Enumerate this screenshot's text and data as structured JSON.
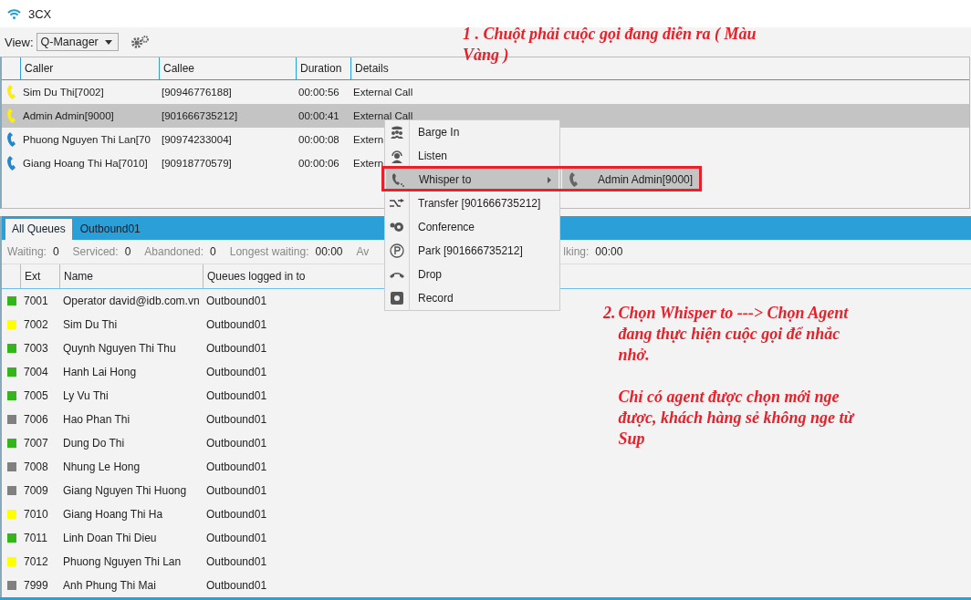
{
  "window": {
    "title": "3CX"
  },
  "toolbar": {
    "view_label": "View:",
    "view_value": "Q-Manager"
  },
  "calls": {
    "columns": [
      "Caller",
      "Callee",
      "Duration",
      "Details"
    ],
    "rows": [
      {
        "caller": "Sim Du Thi[7002]",
        "callee": "[90946776188]",
        "duration": "00:00:56",
        "details": "External Call",
        "color": "#ffee00",
        "selected": false
      },
      {
        "caller": "Admin Admin[9000]",
        "callee": "[901666735212]",
        "duration": "00:00:41",
        "details": "External Call",
        "color": "#ffee00",
        "selected": true
      },
      {
        "caller": "Phuong Nguyen Thi Lan[70",
        "callee": "[90974233004]",
        "duration": "00:00:08",
        "details": "Extern",
        "color": "#1e88d0",
        "selected": false
      },
      {
        "caller": "Giang Hoang Thi Ha[7010]",
        "callee": "[90918770579]",
        "duration": "00:00:06",
        "details": "Extern",
        "color": "#1e88d0",
        "selected": false
      }
    ]
  },
  "context_menu": {
    "items": [
      {
        "label": "Barge In",
        "selected": false,
        "has_submenu": false
      },
      {
        "label": "Listen",
        "selected": false,
        "has_submenu": false
      },
      {
        "label": "Whisper to",
        "selected": true,
        "has_submenu": true
      },
      {
        "label": "Transfer [901666735212]",
        "selected": false,
        "has_submenu": false
      },
      {
        "label": "Conference",
        "selected": false,
        "has_submenu": false
      },
      {
        "label": "Park [901666735212]",
        "selected": false,
        "has_submenu": false
      },
      {
        "label": "Drop",
        "selected": false,
        "has_submenu": false
      },
      {
        "label": "Record",
        "selected": false,
        "has_submenu": false
      }
    ],
    "submenu": [
      {
        "label": "Admin Admin[9000]",
        "selected": true
      }
    ]
  },
  "queues": {
    "tabs": [
      {
        "label": "All Queues",
        "selected": true
      },
      {
        "label": "Outbound01",
        "selected": false
      }
    ],
    "stats": [
      {
        "label": "Waiting:",
        "value": "0"
      },
      {
        "label": "Serviced:",
        "value": "0"
      },
      {
        "label": "Abandoned:",
        "value": "0"
      },
      {
        "label": "Longest waiting:",
        "value": "00:00"
      },
      {
        "label": "Av"
      },
      {
        "label": "lking:",
        "value": "00:00"
      }
    ],
    "columns": [
      "Ext",
      "Name",
      "Queues logged in to"
    ],
    "agents": [
      {
        "ext": "7001",
        "name": "Operator david@idb.com.vn",
        "queues": "Outbound01",
        "color": "#33b51b"
      },
      {
        "ext": "7002",
        "name": "Sim Du Thi",
        "queues": "Outbound01",
        "color": "#ffff00"
      },
      {
        "ext": "7003",
        "name": "Quynh Nguyen Thi Thu",
        "queues": "Outbound01",
        "color": "#33b51b"
      },
      {
        "ext": "7004",
        "name": "Hanh Lai Hong",
        "queues": "Outbound01",
        "color": "#33b51b"
      },
      {
        "ext": "7005",
        "name": "Ly Vu Thi",
        "queues": "Outbound01",
        "color": "#33b51b"
      },
      {
        "ext": "7006",
        "name": "Hao Phan Thi",
        "queues": "Outbound01",
        "color": "#808080"
      },
      {
        "ext": "7007",
        "name": "Dung Do Thi",
        "queues": "Outbound01",
        "color": "#33b51b"
      },
      {
        "ext": "7008",
        "name": "Nhung Le Hong",
        "queues": "Outbound01",
        "color": "#808080"
      },
      {
        "ext": "7009",
        "name": "Giang Nguyen Thi Huong",
        "queues": "Outbound01",
        "color": "#808080"
      },
      {
        "ext": "7010",
        "name": "Giang Hoang Thi Ha",
        "queues": "Outbound01",
        "color": "#ffff00"
      },
      {
        "ext": "7011",
        "name": "Linh Doan Thi Dieu",
        "queues": "Outbound01",
        "color": "#33b51b"
      },
      {
        "ext": "7012",
        "name": "Phuong Nguyen Thi Lan",
        "queues": "Outbound01",
        "color": "#ffff00"
      },
      {
        "ext": "7999",
        "name": "Anh Phung Thi Mai",
        "queues": "Outbound01",
        "color": "#808080"
      }
    ]
  },
  "annotations": [
    {
      "number": "1 .",
      "paragraphs": [
        "Chuột phải cuộc gọi đang diễn ra ( Màu Vàng )"
      ]
    },
    {
      "number": "2.",
      "paragraphs": [
        "Chọn Whisper to ---> Chọn Agent đang thực hiện cuộc gọi để nhắc nhở.",
        "Chỉ có agent được chọn mới nge được, khách hàng sẻ không nge từ Sup"
      ]
    }
  ]
}
